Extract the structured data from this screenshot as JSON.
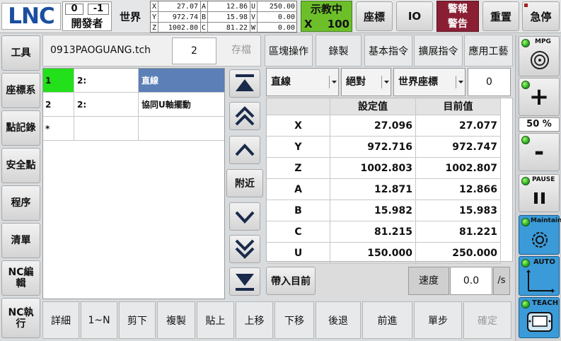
{
  "header": {
    "logo": "LNC",
    "counter_left": "0",
    "counter_right": "-1",
    "mode": "開發者",
    "coord_system": "世界",
    "axes_left": [
      {
        "axis": "X",
        "value": "27.07"
      },
      {
        "axis": "Y",
        "value": "972.74"
      },
      {
        "axis": "Z",
        "value": "1002.80"
      }
    ],
    "axes_mid": [
      {
        "axis": "A",
        "value": "12.86"
      },
      {
        "axis": "B",
        "value": "15.98"
      },
      {
        "axis": "C",
        "value": "81.22"
      }
    ],
    "axes_right": [
      {
        "axis": "U",
        "value": "250.00"
      },
      {
        "axis": "V",
        "value": "0.00"
      },
      {
        "axis": "W",
        "value": "0.00"
      }
    ],
    "teach_status": "示教中",
    "teach_axis": "X",
    "teach_value": "100",
    "coord_button": "座標",
    "io_button": "IO",
    "alarm": "警報",
    "warning": "警告",
    "reset_button": "重置",
    "estop_button": "急停"
  },
  "sidebar": {
    "items": [
      "工具",
      "座標系",
      "點記錄",
      "安全點",
      "程序",
      "清單",
      "NC編輯",
      "NC執行"
    ]
  },
  "toolbar": {
    "filename": "0913PAOGUANG.tch",
    "line_number": "2",
    "save_label": "存檔",
    "block_label": "區塊操作",
    "record_label": "錄製",
    "basic_cmd_label": "基本指令",
    "ext_cmd_label": "擴展指令",
    "app_label": "應用工藝"
  },
  "program": {
    "rows": [
      {
        "num": "1",
        "col2": "2:",
        "cmd": "直線"
      },
      {
        "num": "2",
        "col2": "2:",
        "cmd": "協同U軸擺動"
      },
      {
        "num": "*",
        "col2": "",
        "cmd": ""
      }
    ]
  },
  "nav": {
    "near_label": "附近"
  },
  "motion": {
    "type": "直線",
    "mode": "絕對",
    "coord": "世界座標",
    "index": "0",
    "col_set": "設定值",
    "col_current": "目前值",
    "rows": [
      {
        "axis": "X",
        "set": "27.096",
        "current": "27.077"
      },
      {
        "axis": "Y",
        "set": "972.716",
        "current": "972.747"
      },
      {
        "axis": "Z",
        "set": "1002.803",
        "current": "1002.807"
      },
      {
        "axis": "A",
        "set": "12.871",
        "current": "12.866"
      },
      {
        "axis": "B",
        "set": "15.982",
        "current": "15.983"
      },
      {
        "axis": "C",
        "set": "81.215",
        "current": "81.221"
      },
      {
        "axis": "U",
        "set": "150.000",
        "current": "250.000"
      }
    ],
    "apply_label": "帶入目前",
    "speed_label": "速度",
    "speed_value": "0.0",
    "speed_unit": "/s"
  },
  "bottom": {
    "buttons": [
      "詳細",
      "1~N",
      "剪下",
      "複製",
      "貼上",
      "上移",
      "下移",
      "後退",
      "前進",
      "單步",
      "確定"
    ]
  },
  "right_panel": {
    "mpg_label": "MPG",
    "plus": "+",
    "override": "50 %",
    "minus": "-",
    "pause_label": "PAUSE",
    "maintain_label": "Maintain",
    "auto_label": "AUTO",
    "teach_label": "TEACH"
  },
  "colors": {
    "green_highlight": "#22e01a",
    "selected_cell": "#5b7fb6",
    "teach_bg": "#6dbf2a",
    "alarm_bg": "#8a1f34",
    "panel_blue": "#3a9bd8"
  }
}
